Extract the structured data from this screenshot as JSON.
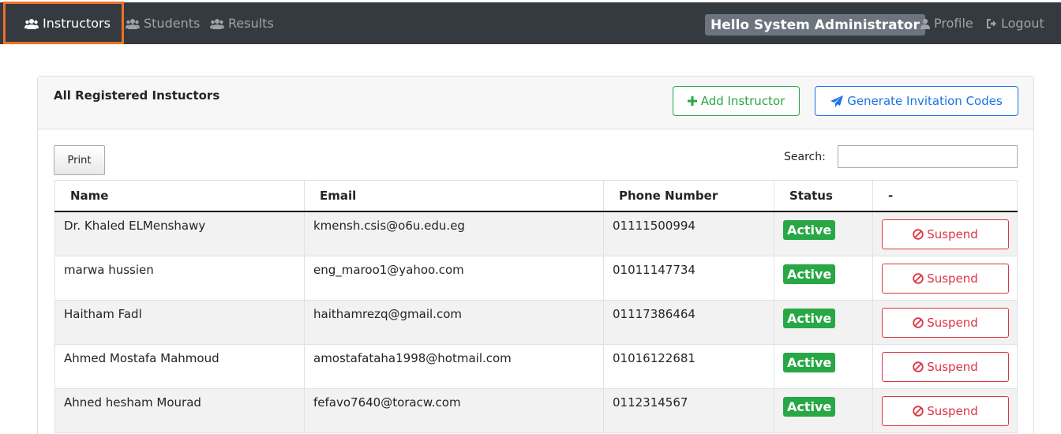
{
  "navbar": {
    "items": [
      {
        "label": "Instructors",
        "icon": "users-icon"
      },
      {
        "label": "Students",
        "icon": "users-icon"
      },
      {
        "label": "Results",
        "icon": "users-icon"
      }
    ],
    "greeting": "Hello System Administrator",
    "profile_label": "Profile",
    "logout_label": "Logout"
  },
  "card": {
    "title": "All Registered Instuctors",
    "add_label": "Add Instructor",
    "generate_label": "Generate Invitation Codes"
  },
  "controls": {
    "print_label": "Print",
    "search_label": "Search:",
    "search_value": ""
  },
  "table": {
    "headers": [
      "Name",
      "Email",
      "Phone Number",
      "Status",
      "-"
    ],
    "rows": [
      {
        "name": "Dr. Khaled ELMenshawy",
        "email": "kmensh.csis@o6u.edu.eg",
        "phone": "01111500994",
        "status": "Active",
        "action": "Suspend"
      },
      {
        "name": "marwa hussien",
        "email": "eng_maroo1@yahoo.com",
        "phone": "01011147734",
        "status": "Active",
        "action": "Suspend"
      },
      {
        "name": "Haitham Fadl",
        "email": "haithamrezq@gmail.com",
        "phone": "01117386464",
        "status": "Active",
        "action": "Suspend"
      },
      {
        "name": "Ahmed Mostafa Mahmoud",
        "email": "amostafataha1998@hotmail.com",
        "phone": "01016122681",
        "status": "Active",
        "action": "Suspend"
      },
      {
        "name": "Ahned hesham Mourad",
        "email": "fefavo7640@toracw.com",
        "phone": "0112314567",
        "status": "Active",
        "action": "Suspend"
      }
    ]
  },
  "colors": {
    "navbar_bg": "#343a40",
    "highlight_border": "#f07027",
    "success": "#28a745",
    "primary": "#1a73e8",
    "danger": "#dc3545"
  }
}
